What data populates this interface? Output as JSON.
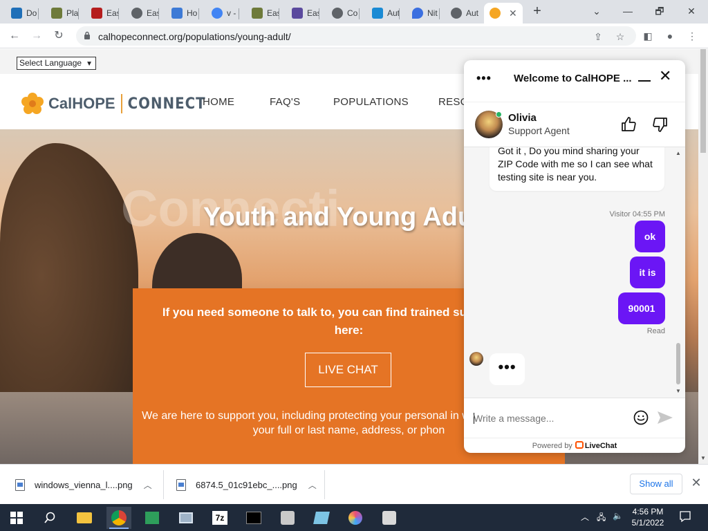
{
  "browser": {
    "tabs": [
      {
        "label": "Do",
        "color": "#1f6fb8"
      },
      {
        "label": "Pla",
        "color": "#6e7a3a"
      },
      {
        "label": "Eas",
        "color": "#b51d1d"
      },
      {
        "label": "Eas",
        "color": "#5f6368"
      },
      {
        "label": "Ho",
        "color": "#3d7ad6"
      },
      {
        "label": "v -",
        "color": "#4285f4"
      },
      {
        "label": "Eas",
        "color": "#6e7a3a"
      },
      {
        "label": "Eas",
        "color": "#5b4a9e"
      },
      {
        "label": "Co",
        "color": "#5f6368"
      },
      {
        "label": "Aut",
        "color": "#1a8ad4"
      },
      {
        "label": "Nit",
        "color": "#3b6fe0"
      },
      {
        "label": "Aut",
        "color": "#5f6368"
      }
    ],
    "active_tab_close": "✕",
    "new_tab": "+",
    "window_controls": {
      "minimize": "⌄",
      "restore": "🗗",
      "close": "✕",
      "min_sym": "—"
    },
    "url": "calhopeconnect.org/populations/young-adult/"
  },
  "page": {
    "language_select": "Select Language",
    "logo": {
      "brand_a": "CalHOPE",
      "brand_b": "CONNECT"
    },
    "nav": [
      "HOME",
      "FAQ'S",
      "POPULATIONS",
      "RESO"
    ],
    "hero_watermark": "Connecti",
    "hero_title": "Youth and Young Adu",
    "orange_text": "If you need someone to talk to, you can find trained supp chat with here:",
    "live_chat_button": "LIVE CHAT",
    "orange_text2": "We are here to support you, including protecting your personal in won't be a need for your full or last name, address, or phon"
  },
  "chat": {
    "title": "Welcome to CalHOPE ...",
    "agent_name": "Olivia",
    "agent_role": "Support Agent",
    "agent_message": "Got it , Do you mind sharing your ZIP Code with me so I can see what testing site is near you.",
    "visitor_meta": "Visitor 04:55 PM",
    "visitor_messages": [
      "ok",
      "it is",
      "90001"
    ],
    "read_label": "Read",
    "typing": "•••",
    "input_placeholder": "Write a message...",
    "powered_by": "Powered by",
    "powered_brand": "LiveChat"
  },
  "downloads": {
    "items": [
      "windows_vienna_l....png",
      "6874.5_01c91ebc_....png"
    ],
    "show_all": "Show all"
  },
  "taskbar": {
    "time": "4:56 PM",
    "date": "5/1/2022"
  }
}
